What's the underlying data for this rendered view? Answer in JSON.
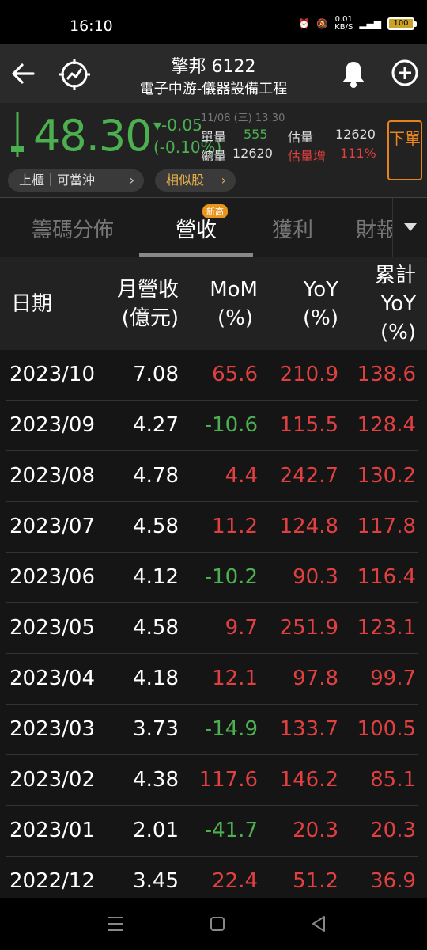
{
  "status": {
    "time": "16:10",
    "net_speed": "0.01",
    "net_unit": "KB/S",
    "battery": "100"
  },
  "header": {
    "title": "擎邦 6122",
    "subtitle": "電子中游-儀器設備工程"
  },
  "quote": {
    "price": "48.30",
    "change": "▾-0.05",
    "change_pct": "(-0.10%)",
    "datetime": "11/08 (三) 13:30",
    "single_vol_label": "單量",
    "single_vol": "555",
    "total_vol_label": "總量",
    "total_vol": "12620",
    "est_vol_label": "估量",
    "est_vol": "12620",
    "est_inc_label": "估量增",
    "est_inc": "111%",
    "sell_label": "下單",
    "market_tag": "上櫃｜可當沖",
    "similar": "相似股"
  },
  "tabs": [
    {
      "label": "籌碼分佈"
    },
    {
      "label": "營收"
    },
    {
      "label": "獲利"
    },
    {
      "label": "財報"
    }
  ],
  "tab_badge": "新高",
  "table": {
    "headers": {
      "date": "日期",
      "rev_l1": "月營收",
      "rev_l2": "(億元)",
      "mom_l1": "MoM",
      "mom_l2": "(%)",
      "yoy_l1": "YoY",
      "yoy_l2": "(%)",
      "cum_l1": "累計",
      "cum_l2": "YoY",
      "cum_l3": "(%)"
    },
    "rows": [
      {
        "date": "2023/10",
        "rev": "7.08",
        "mom": "65.6",
        "yoy": "210.9",
        "cum": "138.6"
      },
      {
        "date": "2023/09",
        "rev": "4.27",
        "mom": "-10.6",
        "yoy": "115.5",
        "cum": "128.4"
      },
      {
        "date": "2023/08",
        "rev": "4.78",
        "mom": "4.4",
        "yoy": "242.7",
        "cum": "130.2"
      },
      {
        "date": "2023/07",
        "rev": "4.58",
        "mom": "11.2",
        "yoy": "124.8",
        "cum": "117.8"
      },
      {
        "date": "2023/06",
        "rev": "4.12",
        "mom": "-10.2",
        "yoy": "90.3",
        "cum": "116.4"
      },
      {
        "date": "2023/05",
        "rev": "4.58",
        "mom": "9.7",
        "yoy": "251.9",
        "cum": "123.1"
      },
      {
        "date": "2023/04",
        "rev": "4.18",
        "mom": "12.1",
        "yoy": "97.8",
        "cum": "99.7"
      },
      {
        "date": "2023/03",
        "rev": "3.73",
        "mom": "-14.9",
        "yoy": "133.7",
        "cum": "100.5"
      },
      {
        "date": "2023/02",
        "rev": "4.38",
        "mom": "117.6",
        "yoy": "146.2",
        "cum": "85.1"
      },
      {
        "date": "2023/01",
        "rev": "2.01",
        "mom": "-41.7",
        "yoy": "20.3",
        "cum": "20.3"
      },
      {
        "date": "2022/12",
        "rev": "3.45",
        "mom": "22.4",
        "yoy": "51.2",
        "cum": "36.9"
      }
    ]
  },
  "colors": {
    "up": "#e04040",
    "down": "#4cb050",
    "accent": "#e8821e"
  }
}
